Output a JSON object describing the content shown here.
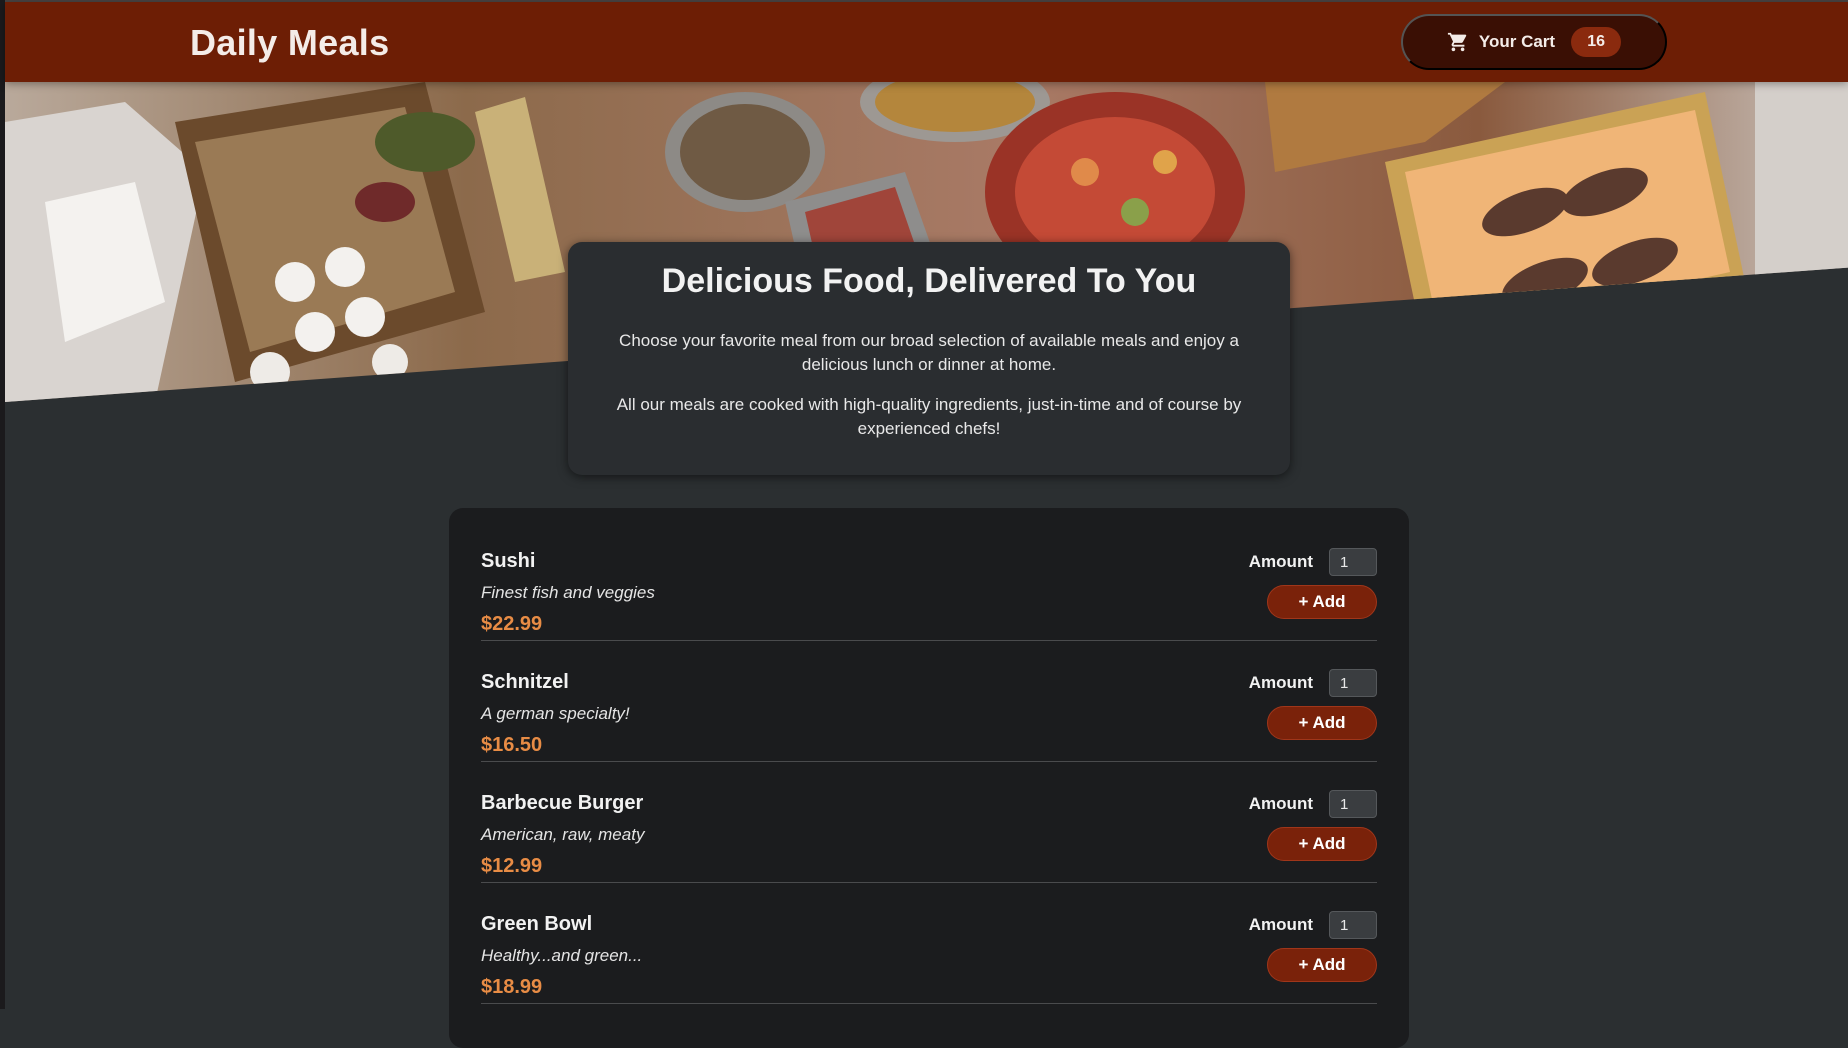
{
  "header": {
    "title": "Daily Meals",
    "cart": {
      "label": "Your Cart",
      "count": "16",
      "icon": "cart-icon"
    }
  },
  "hero": {
    "alt": "A table full of delicious food"
  },
  "summary": {
    "heading": "Delicious Food, Delivered To You",
    "paragraph1": "Choose your favorite meal from our broad selection of available meals and enjoy a delicious lunch or dinner at home.",
    "paragraph2": "All our meals are cooked with high-quality ingredients, just-in-time and of course by experienced chefs!"
  },
  "meals": [
    {
      "name": "Sushi",
      "description": "Finest fish and veggies",
      "price": "$22.99",
      "amount_label": "Amount",
      "amount": "1",
      "add_label": "+ Add"
    },
    {
      "name": "Schnitzel",
      "description": "A german specialty!",
      "price": "$16.50",
      "amount_label": "Amount",
      "amount": "1",
      "add_label": "+ Add"
    },
    {
      "name": "Barbecue Burger",
      "description": "American, raw, meaty",
      "price": "$12.99",
      "amount_label": "Amount",
      "amount": "1",
      "add_label": "+ Add"
    },
    {
      "name": "Green Bowl",
      "description": "Healthy...and green...",
      "price": "$18.99",
      "amount_label": "Amount",
      "amount": "1",
      "add_label": "+ Add"
    }
  ],
  "colors": {
    "header_bg": "#6d1e05",
    "accent_price": "#e88c45",
    "button_bg": "#7a220a",
    "page_bg": "#2b2f31",
    "card_bg": "#1b1c1e"
  }
}
